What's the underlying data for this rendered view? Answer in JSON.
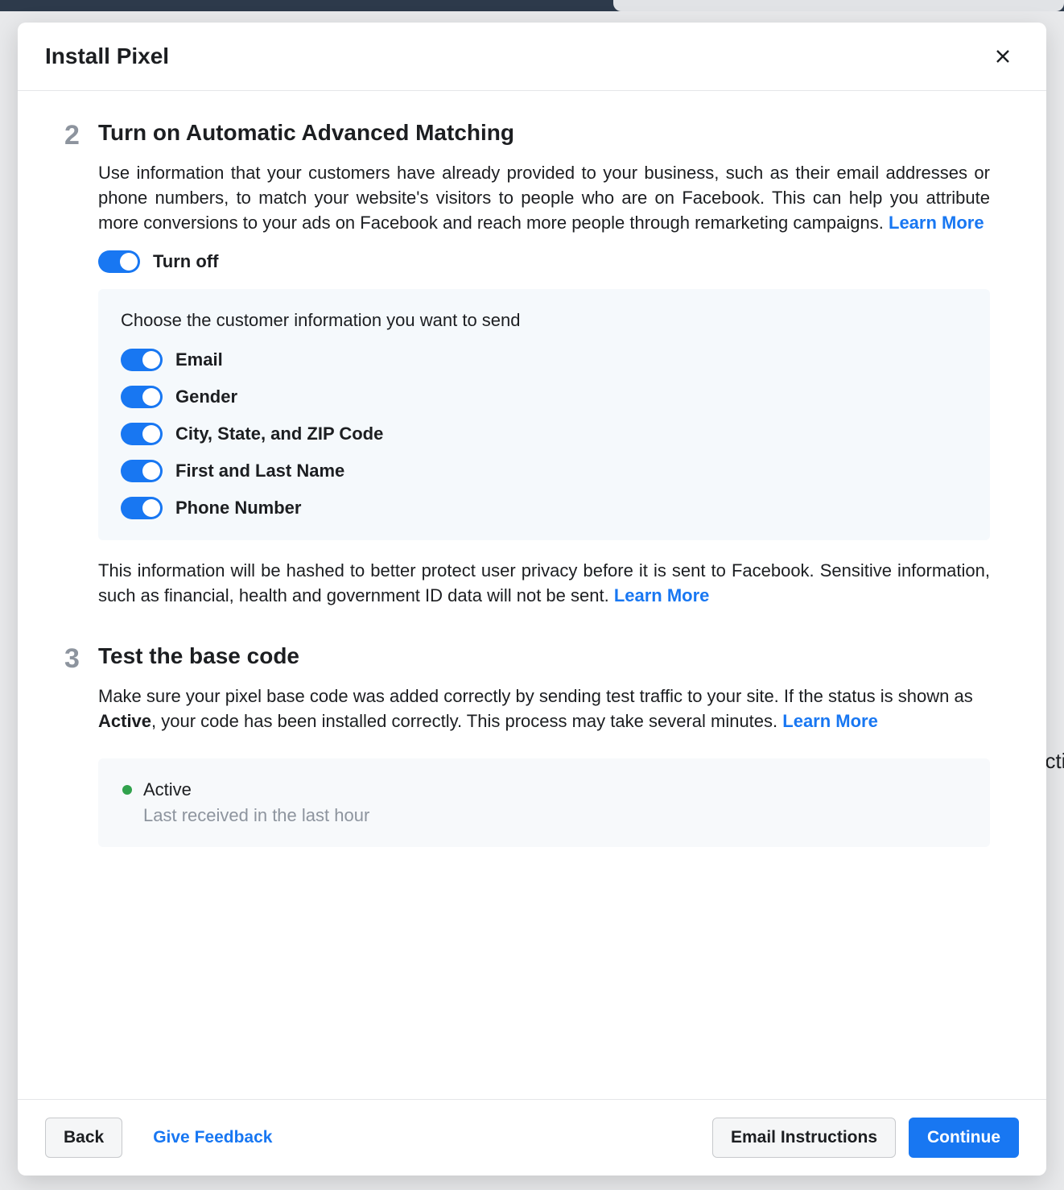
{
  "modal": {
    "title": "Install Pixel",
    "step2": {
      "number": "2",
      "heading": "Turn on Automatic Advanced Matching",
      "description": "Use information that your customers have already provided to your business, such as their email addresses or phone numbers, to match your website's visitors to people who are on Facebook. This can help you attribute more conversions to your ads on Facebook and reach more people through remarketing campaigns. ",
      "learn_more": "Learn More",
      "master_toggle_label": "Turn off",
      "panel_caption": "Choose the customer information you want to send",
      "options": [
        {
          "label": "Email"
        },
        {
          "label": "Gender"
        },
        {
          "label": "City, State, and ZIP Code"
        },
        {
          "label": "First and Last Name"
        },
        {
          "label": "Phone Number"
        }
      ],
      "hash_note": "This information will be hashed to better protect user privacy before it is sent to Facebook. Sensitive information, such as financial, health and government ID data will not be sent. ",
      "hash_learn_more": "Learn More"
    },
    "step3": {
      "number": "3",
      "heading": "Test the base code",
      "desc_pre": "Make sure your pixel base code was added correctly by sending test traffic to your site. If the status is shown as ",
      "desc_bold": "Active",
      "desc_post": ", your code has been installed correctly. This process may take several minutes. ",
      "learn_more": "Learn More",
      "status_label": "Active",
      "status_sub": "Last received in the last hour"
    },
    "footer": {
      "back": "Back",
      "feedback": "Give Feedback",
      "email": "Email Instructions",
      "continue": "Continue"
    }
  }
}
